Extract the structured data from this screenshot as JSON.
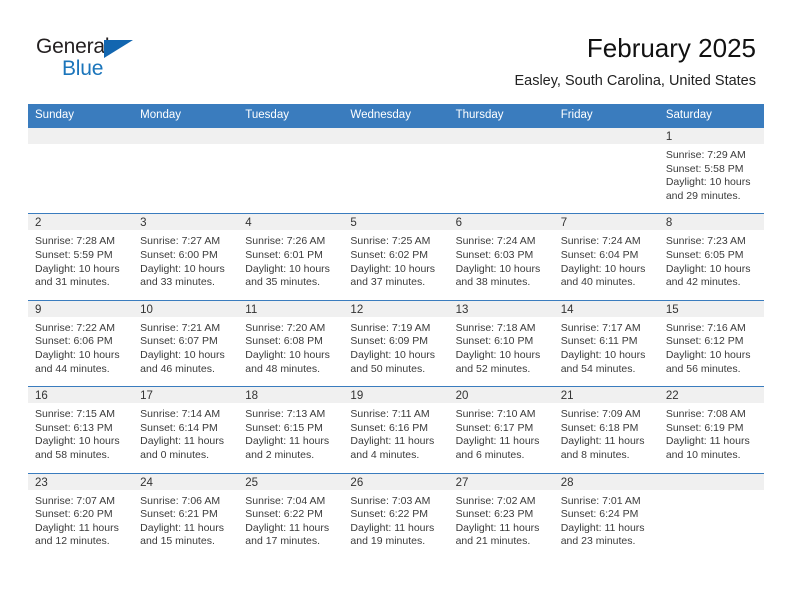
{
  "logo": {
    "word_top": "General",
    "word_bottom": "Blue",
    "triangle_color": "#1266b0",
    "blue_color": "#1b75bb",
    "icon": "general-blue-logo"
  },
  "header": {
    "title": "February 2025",
    "subtitle": "Easley, South Carolina, United States"
  },
  "theme": {
    "header_blue": "#3a7cbe",
    "daynum_band": "#f0f0f0",
    "text": "#3b3b3b"
  },
  "weekday_headers": [
    "Sunday",
    "Monday",
    "Tuesday",
    "Wednesday",
    "Thursday",
    "Friday",
    "Saturday"
  ],
  "labels": {
    "sunrise_prefix": "Sunrise:",
    "sunset_prefix": "Sunset:",
    "daylight_prefix": "Daylight:"
  },
  "weeks": [
    [
      {
        "day": "",
        "empty": true
      },
      {
        "day": "",
        "empty": true
      },
      {
        "day": "",
        "empty": true
      },
      {
        "day": "",
        "empty": true
      },
      {
        "day": "",
        "empty": true
      },
      {
        "day": "",
        "empty": true
      },
      {
        "day": "1",
        "sunrise": "Sunrise: 7:29 AM",
        "sunset": "Sunset: 5:58 PM",
        "daylight": "Daylight: 10 hours and 29 minutes."
      }
    ],
    [
      {
        "day": "2",
        "sunrise": "Sunrise: 7:28 AM",
        "sunset": "Sunset: 5:59 PM",
        "daylight": "Daylight: 10 hours and 31 minutes."
      },
      {
        "day": "3",
        "sunrise": "Sunrise: 7:27 AM",
        "sunset": "Sunset: 6:00 PM",
        "daylight": "Daylight: 10 hours and 33 minutes."
      },
      {
        "day": "4",
        "sunrise": "Sunrise: 7:26 AM",
        "sunset": "Sunset: 6:01 PM",
        "daylight": "Daylight: 10 hours and 35 minutes."
      },
      {
        "day": "5",
        "sunrise": "Sunrise: 7:25 AM",
        "sunset": "Sunset: 6:02 PM",
        "daylight": "Daylight: 10 hours and 37 minutes."
      },
      {
        "day": "6",
        "sunrise": "Sunrise: 7:24 AM",
        "sunset": "Sunset: 6:03 PM",
        "daylight": "Daylight: 10 hours and 38 minutes."
      },
      {
        "day": "7",
        "sunrise": "Sunrise: 7:24 AM",
        "sunset": "Sunset: 6:04 PM",
        "daylight": "Daylight: 10 hours and 40 minutes."
      },
      {
        "day": "8",
        "sunrise": "Sunrise: 7:23 AM",
        "sunset": "Sunset: 6:05 PM",
        "daylight": "Daylight: 10 hours and 42 minutes."
      }
    ],
    [
      {
        "day": "9",
        "sunrise": "Sunrise: 7:22 AM",
        "sunset": "Sunset: 6:06 PM",
        "daylight": "Daylight: 10 hours and 44 minutes."
      },
      {
        "day": "10",
        "sunrise": "Sunrise: 7:21 AM",
        "sunset": "Sunset: 6:07 PM",
        "daylight": "Daylight: 10 hours and 46 minutes."
      },
      {
        "day": "11",
        "sunrise": "Sunrise: 7:20 AM",
        "sunset": "Sunset: 6:08 PM",
        "daylight": "Daylight: 10 hours and 48 minutes."
      },
      {
        "day": "12",
        "sunrise": "Sunrise: 7:19 AM",
        "sunset": "Sunset: 6:09 PM",
        "daylight": "Daylight: 10 hours and 50 minutes."
      },
      {
        "day": "13",
        "sunrise": "Sunrise: 7:18 AM",
        "sunset": "Sunset: 6:10 PM",
        "daylight": "Daylight: 10 hours and 52 minutes."
      },
      {
        "day": "14",
        "sunrise": "Sunrise: 7:17 AM",
        "sunset": "Sunset: 6:11 PM",
        "daylight": "Daylight: 10 hours and 54 minutes."
      },
      {
        "day": "15",
        "sunrise": "Sunrise: 7:16 AM",
        "sunset": "Sunset: 6:12 PM",
        "daylight": "Daylight: 10 hours and 56 minutes."
      }
    ],
    [
      {
        "day": "16",
        "sunrise": "Sunrise: 7:15 AM",
        "sunset": "Sunset: 6:13 PM",
        "daylight": "Daylight: 10 hours and 58 minutes."
      },
      {
        "day": "17",
        "sunrise": "Sunrise: 7:14 AM",
        "sunset": "Sunset: 6:14 PM",
        "daylight": "Daylight: 11 hours and 0 minutes."
      },
      {
        "day": "18",
        "sunrise": "Sunrise: 7:13 AM",
        "sunset": "Sunset: 6:15 PM",
        "daylight": "Daylight: 11 hours and 2 minutes."
      },
      {
        "day": "19",
        "sunrise": "Sunrise: 7:11 AM",
        "sunset": "Sunset: 6:16 PM",
        "daylight": "Daylight: 11 hours and 4 minutes."
      },
      {
        "day": "20",
        "sunrise": "Sunrise: 7:10 AM",
        "sunset": "Sunset: 6:17 PM",
        "daylight": "Daylight: 11 hours and 6 minutes."
      },
      {
        "day": "21",
        "sunrise": "Sunrise: 7:09 AM",
        "sunset": "Sunset: 6:18 PM",
        "daylight": "Daylight: 11 hours and 8 minutes."
      },
      {
        "day": "22",
        "sunrise": "Sunrise: 7:08 AM",
        "sunset": "Sunset: 6:19 PM",
        "daylight": "Daylight: 11 hours and 10 minutes."
      }
    ],
    [
      {
        "day": "23",
        "sunrise": "Sunrise: 7:07 AM",
        "sunset": "Sunset: 6:20 PM",
        "daylight": "Daylight: 11 hours and 12 minutes."
      },
      {
        "day": "24",
        "sunrise": "Sunrise: 7:06 AM",
        "sunset": "Sunset: 6:21 PM",
        "daylight": "Daylight: 11 hours and 15 minutes."
      },
      {
        "day": "25",
        "sunrise": "Sunrise: 7:04 AM",
        "sunset": "Sunset: 6:22 PM",
        "daylight": "Daylight: 11 hours and 17 minutes."
      },
      {
        "day": "26",
        "sunrise": "Sunrise: 7:03 AM",
        "sunset": "Sunset: 6:22 PM",
        "daylight": "Daylight: 11 hours and 19 minutes."
      },
      {
        "day": "27",
        "sunrise": "Sunrise: 7:02 AM",
        "sunset": "Sunset: 6:23 PM",
        "daylight": "Daylight: 11 hours and 21 minutes."
      },
      {
        "day": "28",
        "sunrise": "Sunrise: 7:01 AM",
        "sunset": "Sunset: 6:24 PM",
        "daylight": "Daylight: 11 hours and 23 minutes."
      },
      {
        "day": "",
        "empty": true
      }
    ]
  ]
}
